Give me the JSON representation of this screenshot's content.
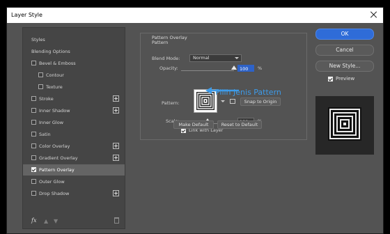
{
  "window": {
    "title": "Layer Style"
  },
  "sidebar": {
    "items": [
      {
        "label": "Styles",
        "checkbox": false,
        "plus": false,
        "sub": false,
        "active": false
      },
      {
        "label": "Blending Options",
        "checkbox": false,
        "plus": false,
        "sub": false,
        "active": false
      },
      {
        "label": "Bevel & Emboss",
        "checkbox": true,
        "checked": false,
        "plus": false,
        "sub": false,
        "active": false
      },
      {
        "label": "Contour",
        "checkbox": true,
        "checked": false,
        "plus": false,
        "sub": true,
        "active": false
      },
      {
        "label": "Texture",
        "checkbox": true,
        "checked": false,
        "plus": false,
        "sub": true,
        "active": false
      },
      {
        "label": "Stroke",
        "checkbox": true,
        "checked": false,
        "plus": true,
        "sub": false,
        "active": false
      },
      {
        "label": "Inner Shadow",
        "checkbox": true,
        "checked": false,
        "plus": true,
        "sub": false,
        "active": false
      },
      {
        "label": "Inner Glow",
        "checkbox": true,
        "checked": false,
        "plus": false,
        "sub": false,
        "active": false
      },
      {
        "label": "Satin",
        "checkbox": true,
        "checked": false,
        "plus": false,
        "sub": false,
        "active": false
      },
      {
        "label": "Color Overlay",
        "checkbox": true,
        "checked": false,
        "plus": true,
        "sub": false,
        "active": false
      },
      {
        "label": "Gradient Overlay",
        "checkbox": true,
        "checked": false,
        "plus": true,
        "sub": false,
        "active": false
      },
      {
        "label": "Pattern Overlay",
        "checkbox": true,
        "checked": true,
        "plus": false,
        "sub": false,
        "active": true
      },
      {
        "label": "Outer Glow",
        "checkbox": true,
        "checked": false,
        "plus": false,
        "sub": false,
        "active": false
      },
      {
        "label": "Drop Shadow",
        "checkbox": true,
        "checked": false,
        "plus": true,
        "sub": false,
        "active": false
      }
    ],
    "fx_label": "fx"
  },
  "panel": {
    "group_title": "Pattern Overlay",
    "group_sub": "Pattern",
    "blend_mode_label": "Blend Mode:",
    "blend_mode_value": "Normal",
    "opacity_label": "Opacity:",
    "opacity_value": "100",
    "opacity_fraction": 1.0,
    "percent": "%",
    "pattern_label": "Pattern:",
    "snap_button": "Snap to Origin",
    "scale_label": "Scale:",
    "scale_value": "100",
    "scale_fraction": 0.5,
    "link_label": "Link with Layer",
    "link_checked": true,
    "make_default": "Make Default",
    "reset_default": "Reset to Default"
  },
  "annotation": {
    "text": "Pilih Jenis Pattern",
    "color": "#3d9be9"
  },
  "right": {
    "ok": "OK",
    "cancel": "Cancel",
    "new_style": "New Style...",
    "preview_label": "Preview",
    "preview_checked": true
  },
  "colors": {
    "accent": "#2f6cd8",
    "dialog_bg": "#535353",
    "selection": "#2d62c8"
  }
}
